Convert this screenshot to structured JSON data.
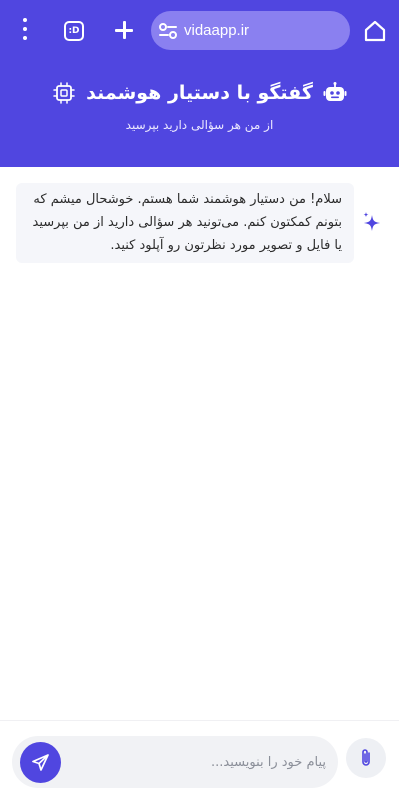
{
  "browser": {
    "url": "vidaapp.ir",
    "tab_count_label": ":D",
    "icons": [
      "more-vert-icon",
      "tabs-icon",
      "new-tab-plus-icon",
      "site-settings-icon",
      "home-icon"
    ]
  },
  "header": {
    "title": "گفتگو با دستیار هوشمند",
    "subtitle": "از من هر سؤالی دارید بپرسید",
    "icons": [
      "chip-icon",
      "robot-icon"
    ],
    "background": "#5046e0"
  },
  "messages": [
    {
      "sender": "assistant",
      "icon": "sparkle-icon",
      "text": "سلام! من دستیار هوشمند شما هستم. خوشحال میشم که بتونم کمکتون کنم. می‌تونید هر سؤالی دارید از من بپرسید یا فایل و تصویر مورد نظرتون رو آپلود کنید."
    }
  ],
  "composer": {
    "placeholder": "پیام خود را بنویسید...",
    "value": "",
    "send_icon": "send-icon",
    "attach_icon": "paperclip-icon"
  },
  "colors": {
    "accent": "#5046e0",
    "url_bar": "#8a80f0",
    "bubble": "#f5f6fa",
    "sparkle": "#5046e0"
  }
}
